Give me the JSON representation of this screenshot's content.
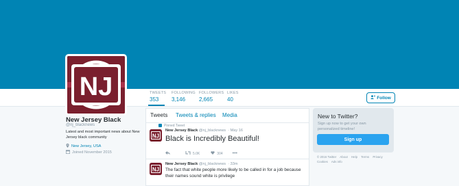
{
  "profile": {
    "name": "New Jersey Black",
    "handle": "@nj_blacknews",
    "bio": "Latest and most important news about New Jersey black community",
    "location": "New Jersey, USA",
    "joined": "Joined November 2015",
    "logo_text": "NJ"
  },
  "stats": [
    {
      "label": "TWEETS",
      "value": "353"
    },
    {
      "label": "FOLLOWING",
      "value": "3,146"
    },
    {
      "label": "FOLLOWERS",
      "value": "2,665"
    },
    {
      "label": "LIKES",
      "value": "40"
    }
  ],
  "follow_label": "Follow",
  "tabs": [
    "Tweets",
    "Tweets & replies",
    "Media"
  ],
  "pinned_label": "Pinned Tweet",
  "tweets": [
    {
      "name": "New Jersey Black",
      "handle": "@nj_blacknews",
      "time": "May 16",
      "text": "Black is Incredibly Beautiful!",
      "retweets": "5.0K",
      "likes": "304"
    },
    {
      "name": "New Jersey Black",
      "handle": "@nj_blacknews",
      "time": "33m",
      "text": "The fact that white people more likely to be called in for a job because their names sound white is privilege"
    }
  ],
  "sidebar": {
    "title": "New to Twitter?",
    "text": "Sign up now to get your own personalized timeline!",
    "signup_label": "Sign up"
  },
  "footer": {
    "line1": [
      "© 2016 Twitter",
      "About",
      "Help",
      "Terms",
      "Privacy"
    ],
    "line2": [
      "Cookies",
      "Ads info"
    ]
  },
  "colors": {
    "header": "#0084b4",
    "accent": "#0084b4",
    "logo_bg": "#7a1f2e"
  }
}
